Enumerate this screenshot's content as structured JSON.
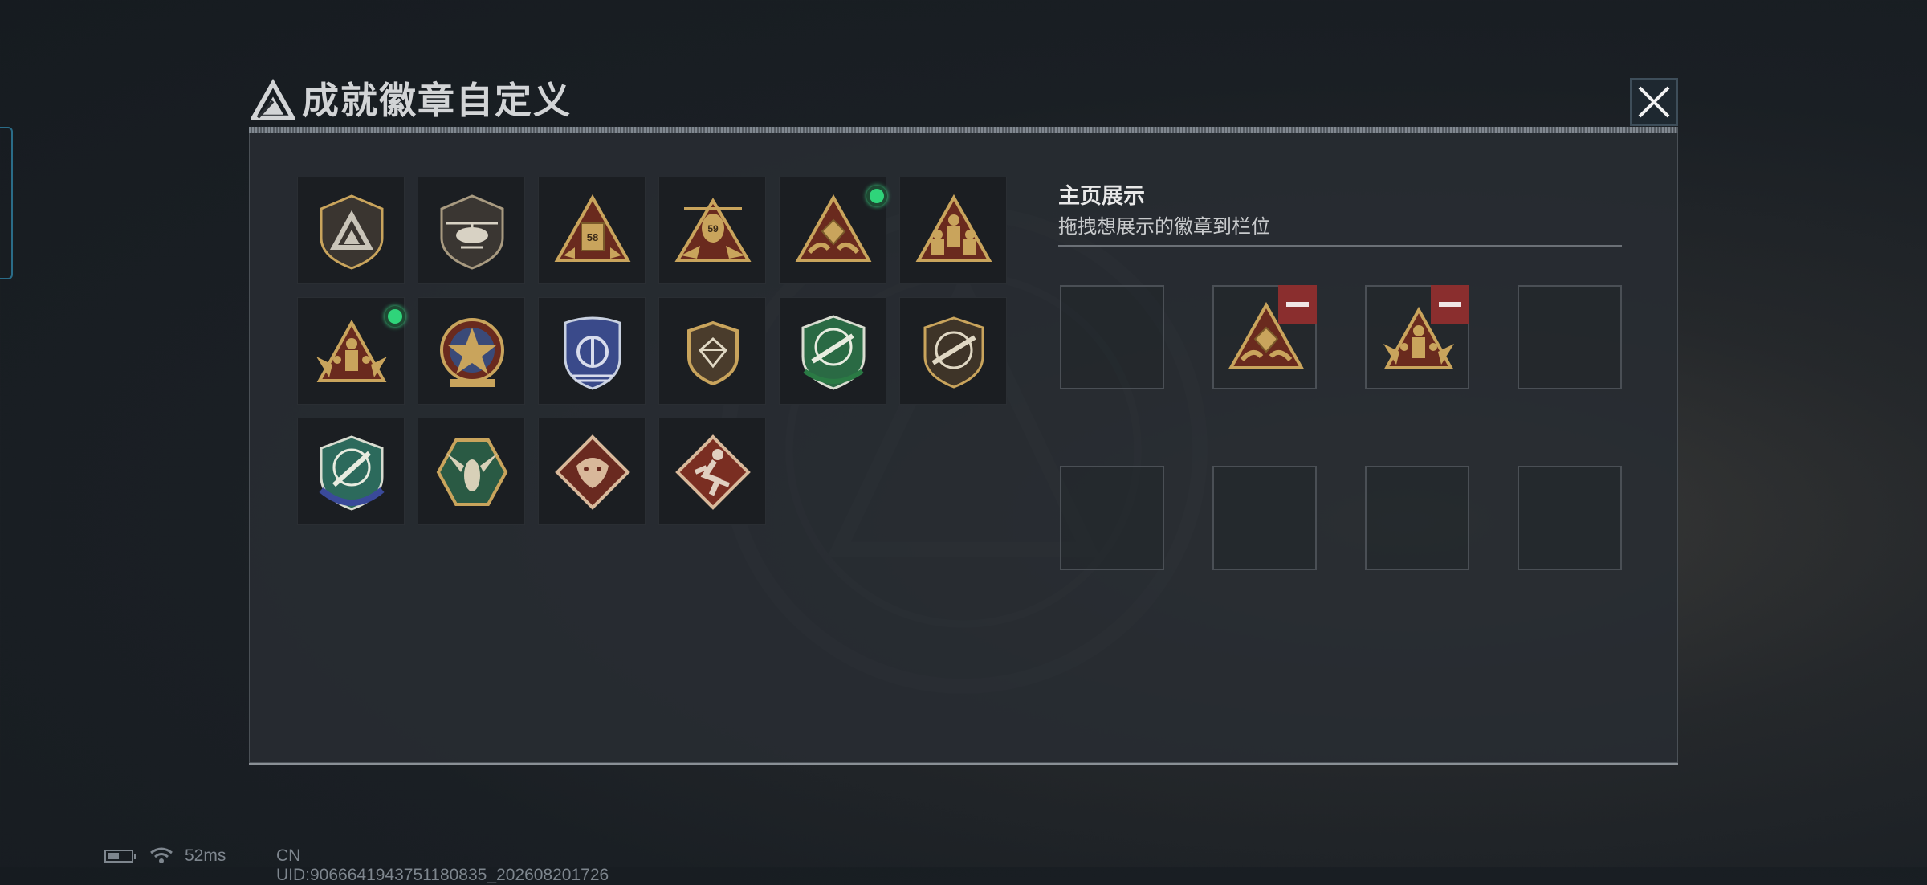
{
  "header": {
    "title": "成就徽章自定义",
    "logo_icon": "triangle-logo-icon",
    "close_icon": "close-icon"
  },
  "badges": [
    {
      "icon": "shield-triangle-badge-icon",
      "active": false
    },
    {
      "icon": "helicopter-shield-badge-icon",
      "active": false
    },
    {
      "icon": "tank-58-triangle-badge-icon",
      "active": false
    },
    {
      "icon": "helicopter-59-triangle-badge-icon",
      "active": false
    },
    {
      "icon": "gem-hands-triangle-badge-icon",
      "active": true
    },
    {
      "icon": "soldiers-triangle-badge-icon",
      "active": false
    },
    {
      "icon": "soldiers-wings-badge-icon",
      "active": true
    },
    {
      "icon": "star-medal-badge-icon",
      "active": false
    },
    {
      "icon": "blue-police-badge-icon",
      "active": false
    },
    {
      "icon": "gem-shield-badge-icon",
      "active": false
    },
    {
      "icon": "green-rifle-shield-badge-icon",
      "active": false
    },
    {
      "icon": "brown-rifle-shield-badge-icon",
      "active": false
    },
    {
      "icon": "blue-knife-shield-badge-icon",
      "active": false
    },
    {
      "icon": "hornet-hexagon-badge-icon",
      "active": false
    },
    {
      "icon": "dragon-diamond-badge-icon",
      "active": false
    },
    {
      "icon": "runner-diamond-badge-icon",
      "active": false
    }
  ],
  "display": {
    "title": "主页展示",
    "subtitle": "拖拽想展示的徽章到栏位",
    "slots": [
      {
        "filled": false,
        "icon": ""
      },
      {
        "filled": true,
        "icon": "gem-hands-triangle-badge-icon"
      },
      {
        "filled": true,
        "icon": "soldiers-wings-badge-icon"
      },
      {
        "filled": false,
        "icon": ""
      },
      {
        "filled": false,
        "icon": ""
      },
      {
        "filled": false,
        "icon": ""
      },
      {
        "filled": false,
        "icon": ""
      },
      {
        "filled": false,
        "icon": ""
      }
    ]
  },
  "statusbar": {
    "ping": "52ms",
    "uid": "CN UID:9066641943751180835_202608201726"
  },
  "colors": {
    "gold": "#c9a45c",
    "dark_gold": "#7a5a2a",
    "active_dot": "#2fd47a",
    "remove_red": "#8a2e2e"
  }
}
